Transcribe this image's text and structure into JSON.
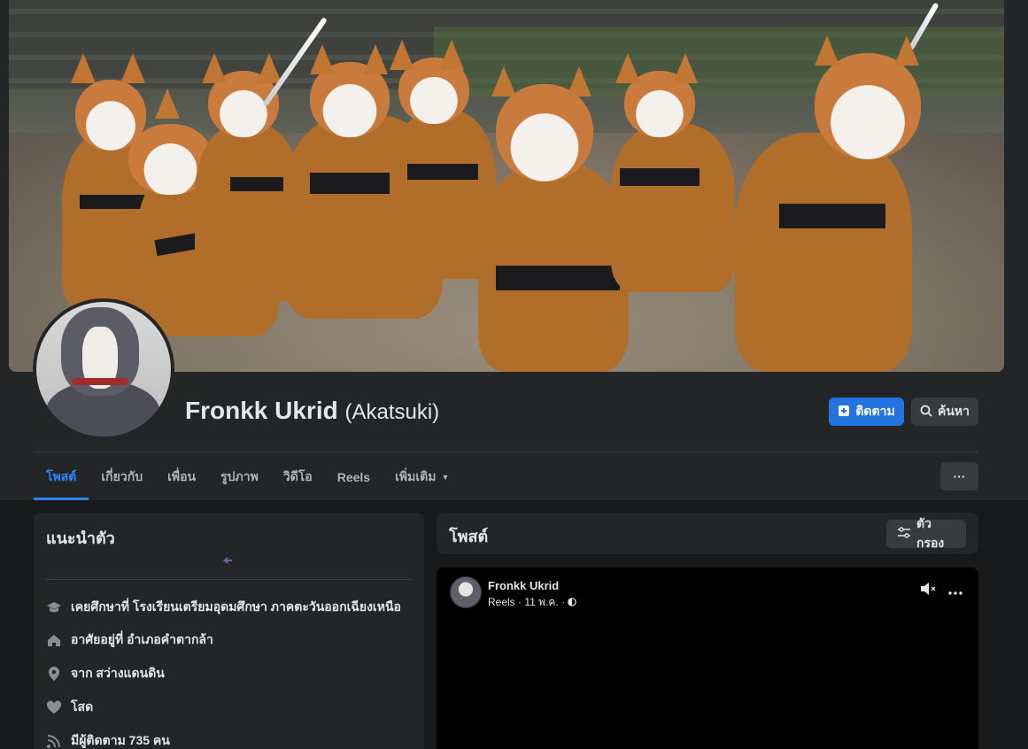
{
  "profile": {
    "name": "Fronkk Ukrid",
    "alt_name": "(Akatsuki)"
  },
  "actions": {
    "follow_label": "ติดตาม",
    "search_label": "ค้นหา",
    "more_label": "···"
  },
  "tabs": [
    {
      "label": "โพสต์",
      "active": true
    },
    {
      "label": "เกี่ยวกับ"
    },
    {
      "label": "เพื่อน"
    },
    {
      "label": "รูปภาพ"
    },
    {
      "label": "วิดีโอ"
    },
    {
      "label": "Reels"
    },
    {
      "label": "เพิ่มเติม",
      "caret": "▼"
    }
  ],
  "intro": {
    "title": "แนะนำตัว",
    "back_text": "BACK",
    "items": [
      {
        "icon": "graduation-cap-icon",
        "text": "เคยศึกษาที่ โรงเรียนเตรียมอุดมศึกษา ภาคตะวันออกเฉียงเหนือ"
      },
      {
        "icon": "home-icon",
        "text": "อาศัยอยู่ที่ อำเภอคำตากล้า"
      },
      {
        "icon": "location-pin-icon",
        "text": "จาก สว่างแดนดิน"
      },
      {
        "icon": "heart-icon",
        "text": "โสด"
      },
      {
        "icon": "rss-followers-icon",
        "text": "มีผู้ติดตาม 735 คน"
      }
    ]
  },
  "posts": {
    "title": "โพสต์",
    "filter_label": "ตัวกรอง",
    "post": {
      "author": "Fronkk Ukrid",
      "meta": "Reels · 11 พ.ค. ·"
    }
  },
  "colors": {
    "accent": "#2374e1",
    "tab_active": "#2d88ff",
    "page_bg": "#18191a",
    "card_bg": "#242526"
  }
}
